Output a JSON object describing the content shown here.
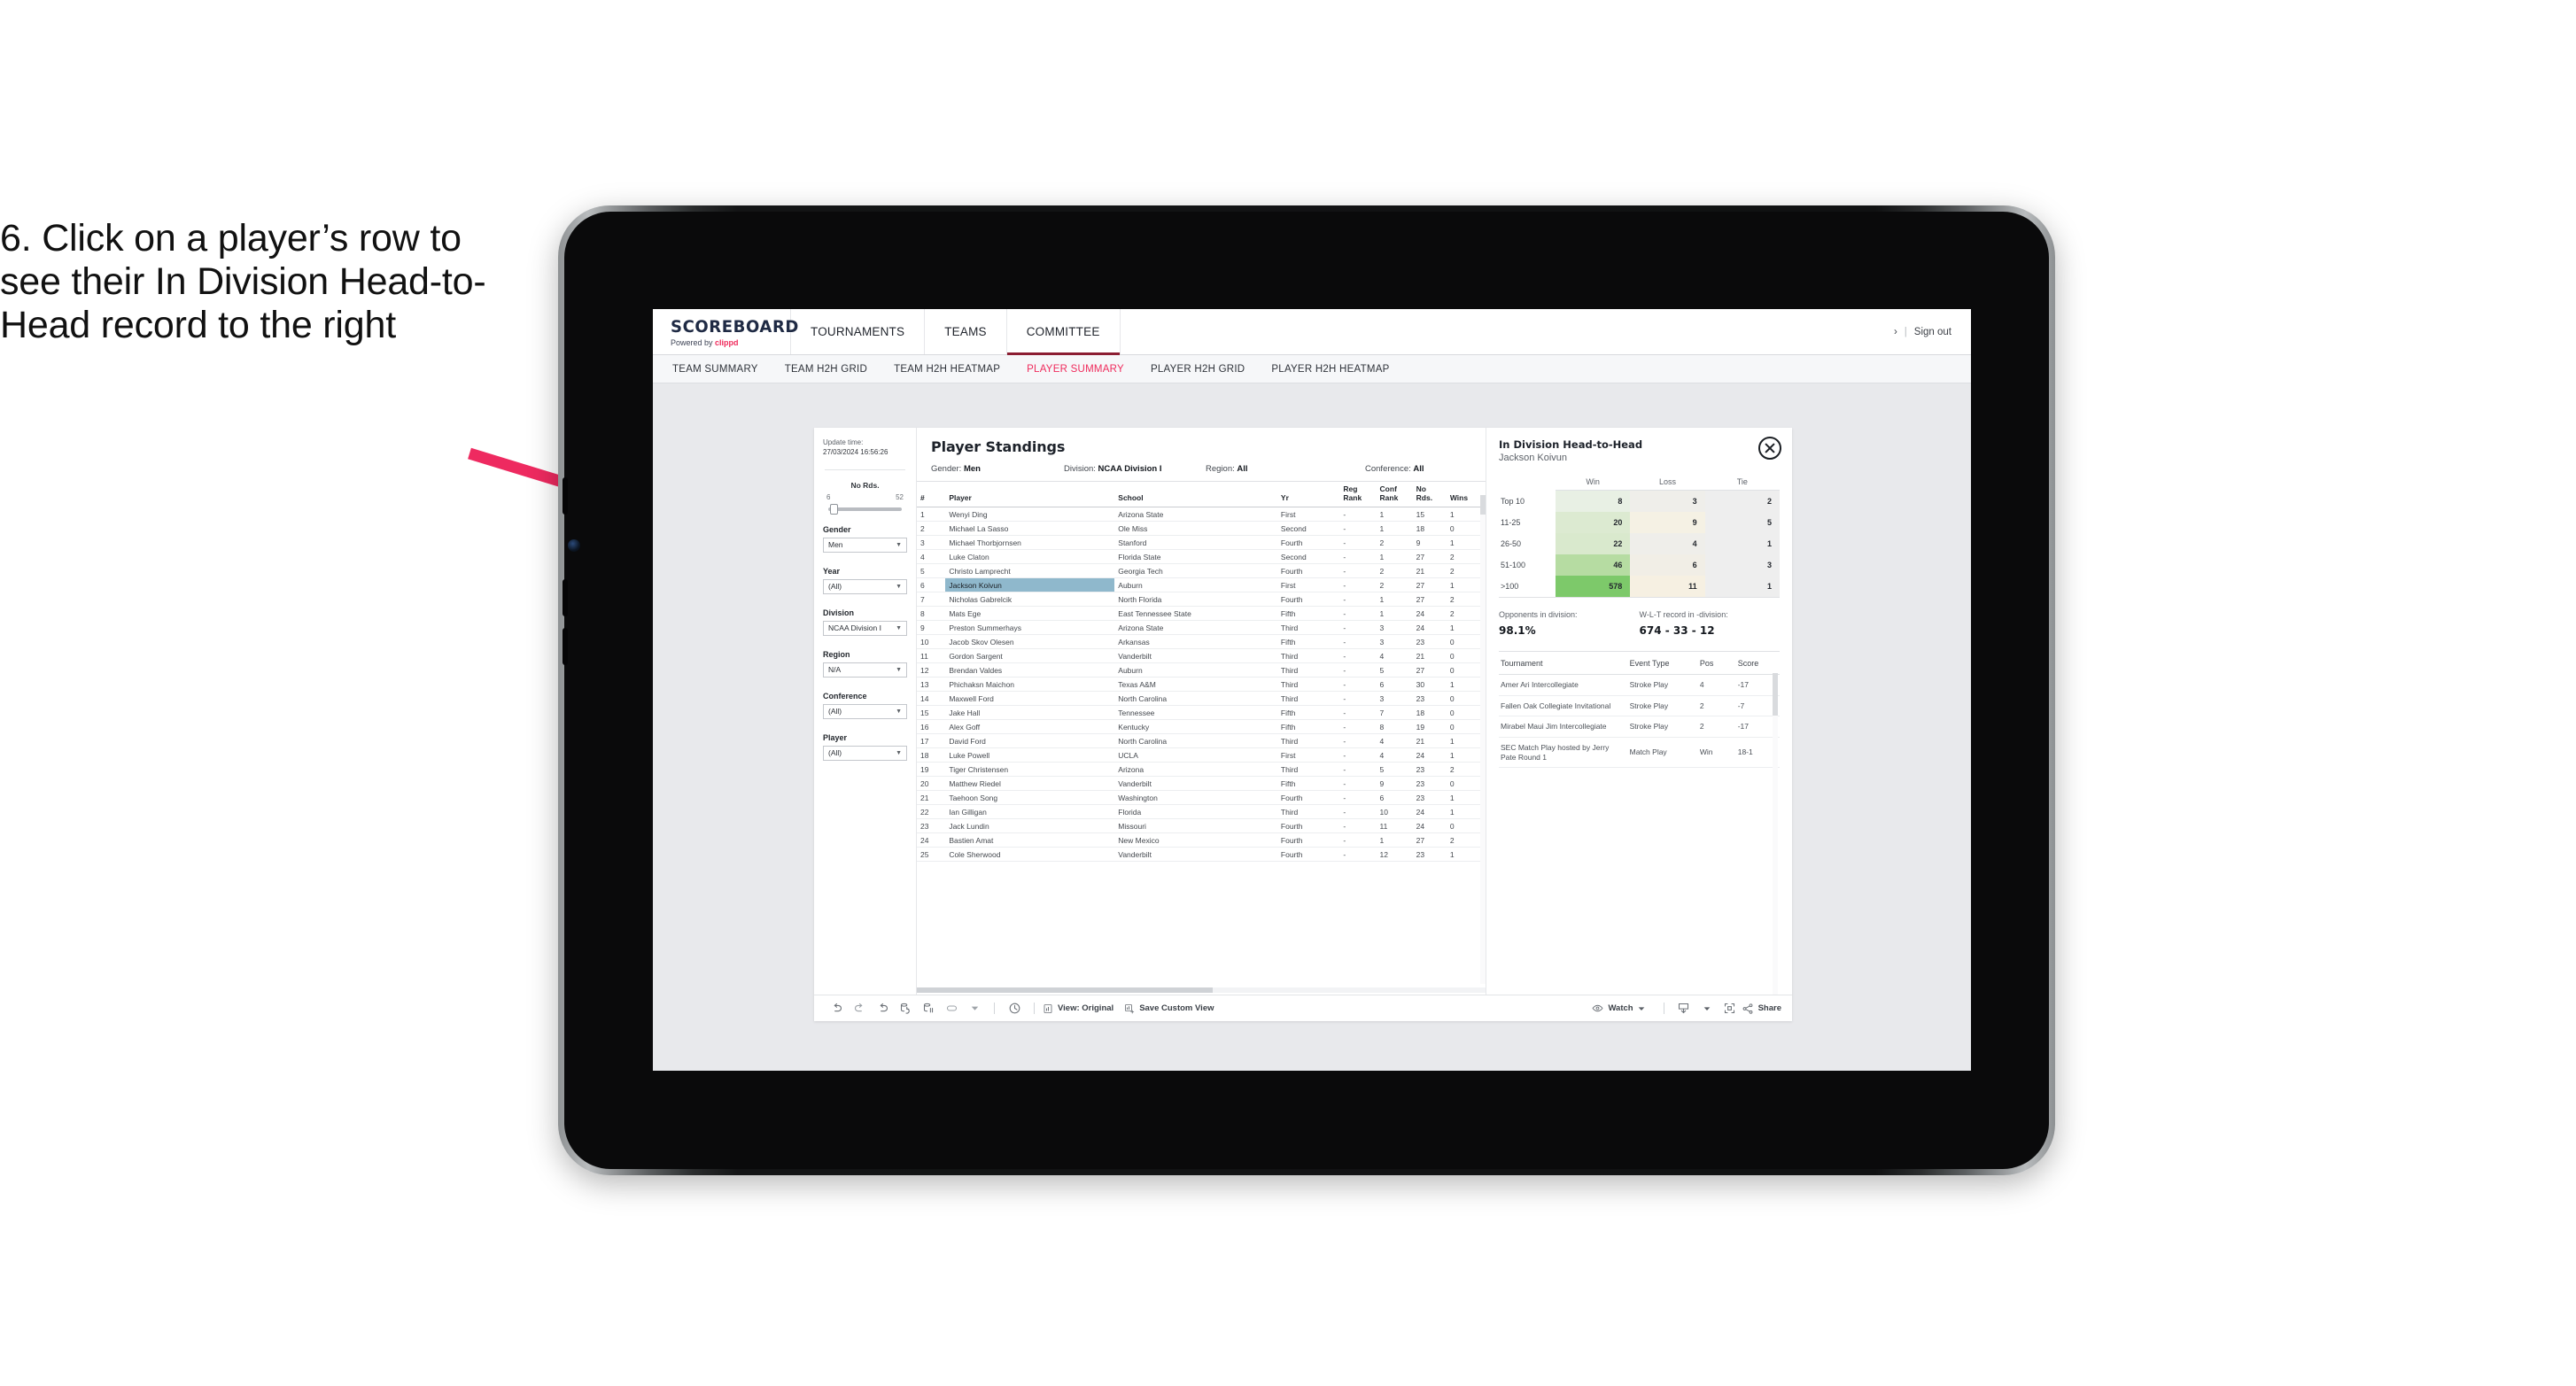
{
  "caption": {
    "text": "6. Click on a player’s row to see their In Division Head-to-Head record to the right",
    "arrow_color": "#ee2a60"
  },
  "app": {
    "logo": {
      "main": "SCOREBOARD",
      "powered_prefix": "Powered by ",
      "brand": "clippd"
    },
    "top_nav": [
      {
        "label": "TOURNAMENTS",
        "active": false
      },
      {
        "label": "TEAMS",
        "active": false
      },
      {
        "label": "COMMITTEE",
        "active": true
      }
    ],
    "header_right": {
      "chevron": "›",
      "separator": "|",
      "sign_out": "Sign out"
    },
    "sub_nav": [
      {
        "label": "TEAM SUMMARY",
        "active": false
      },
      {
        "label": "TEAM H2H GRID",
        "active": false
      },
      {
        "label": "TEAM H2H HEATMAP",
        "active": false
      },
      {
        "label": "PLAYER SUMMARY",
        "active": true
      },
      {
        "label": "PLAYER H2H GRID",
        "active": false
      },
      {
        "label": "PLAYER H2H HEATMAP",
        "active": false
      }
    ],
    "accent_color": "#ef2b5c"
  },
  "filters": {
    "update_label": "Update time:",
    "update_value": "27/03/2024 16:56:26",
    "slider": {
      "title": "No Rds.",
      "min": "6",
      "max": "52"
    },
    "groups": [
      {
        "label": "Gender",
        "value": "Men"
      },
      {
        "label": "Year",
        "value": "(All)"
      },
      {
        "label": "Division",
        "value": "NCAA Division I"
      },
      {
        "label": "Region",
        "value": "N/A"
      },
      {
        "label": "Conference",
        "value": "(All)"
      },
      {
        "label": "Player",
        "value": "(All)"
      }
    ]
  },
  "standings": {
    "title": "Player Standings",
    "meta": [
      {
        "label": "Gender: ",
        "value": "Men"
      },
      {
        "label": "Division: ",
        "value": "NCAA Division I"
      },
      {
        "label": "Region: ",
        "value": "All"
      },
      {
        "label": "Conference: ",
        "value": "All"
      }
    ],
    "columns": [
      "#",
      "Player",
      "School",
      "Yr",
      "Reg Rank",
      "Conf Rank",
      "No Rds.",
      "Wins"
    ],
    "rows": [
      {
        "num": "1",
        "player": "Wenyi Ding",
        "school": "Arizona State",
        "yr": "First",
        "reg": "-",
        "conf": "1",
        "rds": "15",
        "wins": "1",
        "selected": false
      },
      {
        "num": "2",
        "player": "Michael La Sasso",
        "school": "Ole Miss",
        "yr": "Second",
        "reg": "-",
        "conf": "1",
        "rds": "18",
        "wins": "0",
        "selected": false
      },
      {
        "num": "3",
        "player": "Michael Thorbjornsen",
        "school": "Stanford",
        "yr": "Fourth",
        "reg": "-",
        "conf": "2",
        "rds": "9",
        "wins": "1",
        "selected": false
      },
      {
        "num": "4",
        "player": "Luke Claton",
        "school": "Florida State",
        "yr": "Second",
        "reg": "-",
        "conf": "1",
        "rds": "27",
        "wins": "2",
        "selected": false
      },
      {
        "num": "5",
        "player": "Christo Lamprecht",
        "school": "Georgia Tech",
        "yr": "Fourth",
        "reg": "-",
        "conf": "2",
        "rds": "21",
        "wins": "2",
        "selected": false
      },
      {
        "num": "6",
        "player": "Jackson Koivun",
        "school": "Auburn",
        "yr": "First",
        "reg": "-",
        "conf": "2",
        "rds": "27",
        "wins": "1",
        "selected": true
      },
      {
        "num": "7",
        "player": "Nicholas Gabrelcik",
        "school": "North Florida",
        "yr": "Fourth",
        "reg": "-",
        "conf": "1",
        "rds": "27",
        "wins": "2",
        "selected": false
      },
      {
        "num": "8",
        "player": "Mats Ege",
        "school": "East Tennessee State",
        "yr": "Fifth",
        "reg": "-",
        "conf": "1",
        "rds": "24",
        "wins": "2",
        "selected": false
      },
      {
        "num": "9",
        "player": "Preston Summerhays",
        "school": "Arizona State",
        "yr": "Third",
        "reg": "-",
        "conf": "3",
        "rds": "24",
        "wins": "1",
        "selected": false
      },
      {
        "num": "10",
        "player": "Jacob Skov Olesen",
        "school": "Arkansas",
        "yr": "Fifth",
        "reg": "-",
        "conf": "3",
        "rds": "23",
        "wins": "0",
        "selected": false
      },
      {
        "num": "11",
        "player": "Gordon Sargent",
        "school": "Vanderbilt",
        "yr": "Third",
        "reg": "-",
        "conf": "4",
        "rds": "21",
        "wins": "0",
        "selected": false
      },
      {
        "num": "12",
        "player": "Brendan Valdes",
        "school": "Auburn",
        "yr": "Third",
        "reg": "-",
        "conf": "5",
        "rds": "27",
        "wins": "0",
        "selected": false
      },
      {
        "num": "13",
        "player": "Phichaksn Maichon",
        "school": "Texas A&M",
        "yr": "Third",
        "reg": "-",
        "conf": "6",
        "rds": "30",
        "wins": "1",
        "selected": false
      },
      {
        "num": "14",
        "player": "Maxwell Ford",
        "school": "North Carolina",
        "yr": "Third",
        "reg": "-",
        "conf": "3",
        "rds": "23",
        "wins": "0",
        "selected": false
      },
      {
        "num": "15",
        "player": "Jake Hall",
        "school": "Tennessee",
        "yr": "Fifth",
        "reg": "-",
        "conf": "7",
        "rds": "18",
        "wins": "0",
        "selected": false
      },
      {
        "num": "16",
        "player": "Alex Goff",
        "school": "Kentucky",
        "yr": "Fifth",
        "reg": "-",
        "conf": "8",
        "rds": "19",
        "wins": "0",
        "selected": false
      },
      {
        "num": "17",
        "player": "David Ford",
        "school": "North Carolina",
        "yr": "Third",
        "reg": "-",
        "conf": "4",
        "rds": "21",
        "wins": "1",
        "selected": false
      },
      {
        "num": "18",
        "player": "Luke Powell",
        "school": "UCLA",
        "yr": "First",
        "reg": "-",
        "conf": "4",
        "rds": "24",
        "wins": "1",
        "selected": false
      },
      {
        "num": "19",
        "player": "Tiger Christensen",
        "school": "Arizona",
        "yr": "Third",
        "reg": "-",
        "conf": "5",
        "rds": "23",
        "wins": "2",
        "selected": false
      },
      {
        "num": "20",
        "player": "Matthew Riedel",
        "school": "Vanderbilt",
        "yr": "Fifth",
        "reg": "-",
        "conf": "9",
        "rds": "23",
        "wins": "0",
        "selected": false
      },
      {
        "num": "21",
        "player": "Taehoon Song",
        "school": "Washington",
        "yr": "Fourth",
        "reg": "-",
        "conf": "6",
        "rds": "23",
        "wins": "1",
        "selected": false
      },
      {
        "num": "22",
        "player": "Ian Gilligan",
        "school": "Florida",
        "yr": "Third",
        "reg": "-",
        "conf": "10",
        "rds": "24",
        "wins": "1",
        "selected": false
      },
      {
        "num": "23",
        "player": "Jack Lundin",
        "school": "Missouri",
        "yr": "Fourth",
        "reg": "-",
        "conf": "11",
        "rds": "24",
        "wins": "0",
        "selected": false
      },
      {
        "num": "24",
        "player": "Bastien Amat",
        "school": "New Mexico",
        "yr": "Fourth",
        "reg": "-",
        "conf": "1",
        "rds": "27",
        "wins": "2",
        "selected": false
      },
      {
        "num": "25",
        "player": "Cole Sherwood",
        "school": "Vanderbilt",
        "yr": "Fourth",
        "reg": "-",
        "conf": "12",
        "rds": "23",
        "wins": "1",
        "selected": false
      }
    ]
  },
  "h2h": {
    "title": "In Division Head-to-Head",
    "player": "Jackson Koivun",
    "close_icon": "close-circle-icon",
    "columns": [
      "",
      "Win",
      "Loss",
      "Tie"
    ],
    "rows": [
      {
        "bucket": "Top 10",
        "win": "8",
        "loss": "3",
        "tie": "2",
        "win_color": "#e8f0e4",
        "loss_color": "#efeeea",
        "tie_color": "#eeeeee"
      },
      {
        "bucket": "11-25",
        "win": "20",
        "loss": "9",
        "tie": "5",
        "win_color": "#dcead1",
        "loss_color": "#f5f1e4",
        "tie_color": "#eeeeee"
      },
      {
        "bucket": "26-50",
        "win": "22",
        "loss": "4",
        "tie": "1",
        "win_color": "#d9e9cd",
        "loss_color": "#efeeea",
        "tie_color": "#eeeeee"
      },
      {
        "bucket": "51-100",
        "win": "46",
        "loss": "6",
        "tie": "3",
        "win_color": "#b6dca2",
        "loss_color": "#f1eee6",
        "tie_color": "#eeeeee"
      },
      {
        "bucket": ">100",
        "win": "578",
        "loss": "11",
        "tie": "1",
        "win_color": "#7dc96a",
        "loss_color": "#f6f0e2",
        "tie_color": "#eeeeee"
      }
    ],
    "summary": [
      {
        "label": "Opponents in division:",
        "value": "98.1%"
      },
      {
        "label": "W-L-T record in -division:",
        "value": "674 - 33 - 12"
      }
    ],
    "tourney_columns": [
      "Tournament",
      "Event Type",
      "Pos",
      "Score"
    ],
    "tourney_rows": [
      {
        "name": "Amer Ari Intercollegiate",
        "type": "Stroke Play",
        "pos": "4",
        "score": "-17"
      },
      {
        "name": "Fallen Oak Collegiate Invitational",
        "type": "Stroke Play",
        "pos": "2",
        "score": "-7"
      },
      {
        "name": "Mirabel Maui Jim Intercollegiate",
        "type": "Stroke Play",
        "pos": "2",
        "score": "-17"
      },
      {
        "name": "SEC Match Play hosted by Jerry Pate Round 1",
        "type": "Match Play",
        "pos": "Win",
        "score": "18-1"
      }
    ]
  },
  "toolbar": {
    "icons": [
      "undo-icon",
      "redo-icon",
      "revert-icon",
      "refresh-data-icon",
      "pause-auto-update-icon",
      "highlight-icon",
      "chevron-down-icon",
      "history-icon"
    ],
    "view_original_label": "View: Original",
    "view_original_icon": "view-original-icon",
    "save_custom_view_label": "Save Custom View",
    "save_custom_view_icon": "save-view-icon",
    "watch_label": "Watch",
    "watch_icon": "eye-icon",
    "download_icon": "download-icon",
    "fullscreen_icon": "fullscreen-icon",
    "share_label": "Share",
    "share_icon": "share-icon"
  }
}
